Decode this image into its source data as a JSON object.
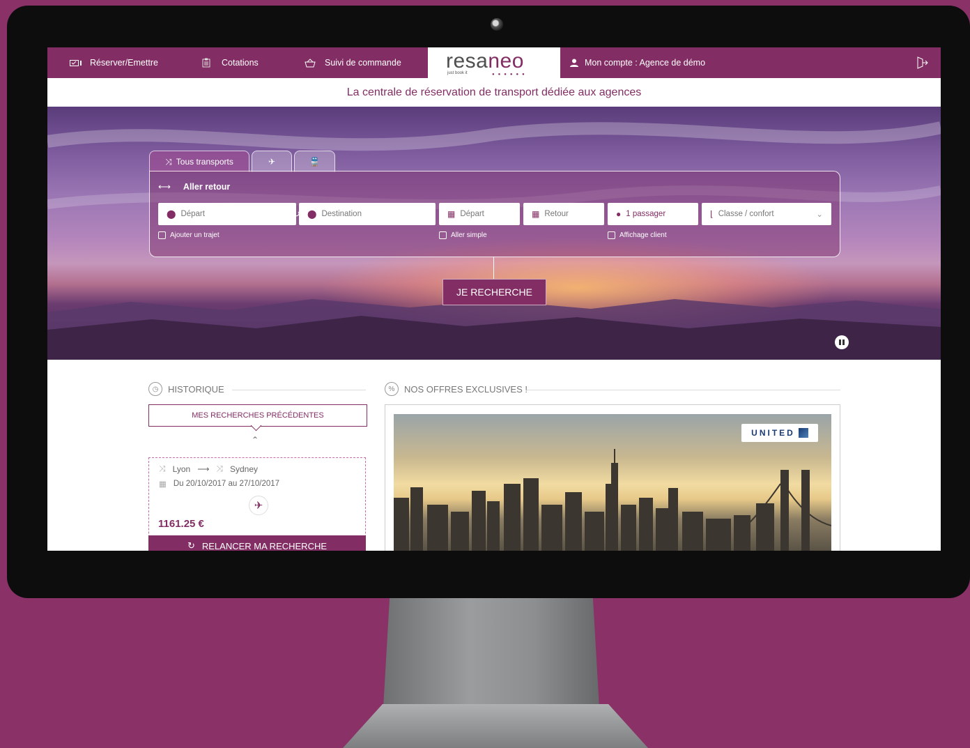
{
  "nav": {
    "book": "Réserver/Emettre",
    "quotes": "Cotations",
    "orders": "Suivi de commande",
    "account": "Mon compte : Agence de démo"
  },
  "logo": {
    "main_a": "resa",
    "main_b": "neo",
    "tagline": "just book it"
  },
  "tagline": "La centrale de réservation de transport dédiée aux agences",
  "search": {
    "tab_all": "Tous transports",
    "trip_type": "Aller retour",
    "departure_place": "Départ",
    "destination": "Destination",
    "departure_date": "Départ",
    "return_date": "Retour",
    "passengers": "1 passager",
    "class": "Classe / confort",
    "add_trip": "Ajouter un trajet",
    "one_way": "Aller simple",
    "client_display": "Affichage client",
    "button": "JE RECHERCHE"
  },
  "history": {
    "title": "HISTORIQUE",
    "previous": "MES RECHERCHES PRÉCÉDENTES",
    "from": "Lyon",
    "to": "Sydney",
    "dates": "Du 20/10/2017 au 27/10/2017",
    "price": "1161.25 €",
    "relaunch": "RELANCER MA RECHERCHE"
  },
  "offers": {
    "title": "NOS OFFRES EXCLUSIVES !",
    "airline": "UNITED"
  },
  "colors": {
    "brand": "#822d63",
    "background": "#8a3167"
  },
  "icons": [
    "checklist-icon",
    "clipboard-icon",
    "basket-icon",
    "user-icon",
    "exit-icon",
    "shuffle-icon",
    "plane-icon",
    "train-icon",
    "swap-arrows-icon",
    "pin-icon",
    "refresh-icon",
    "calendar-icon",
    "seat-icon",
    "chevron-down-icon",
    "pause-icon",
    "clock-icon",
    "percent-icon",
    "chevron-up-icon",
    "arrow-right-icon"
  ]
}
